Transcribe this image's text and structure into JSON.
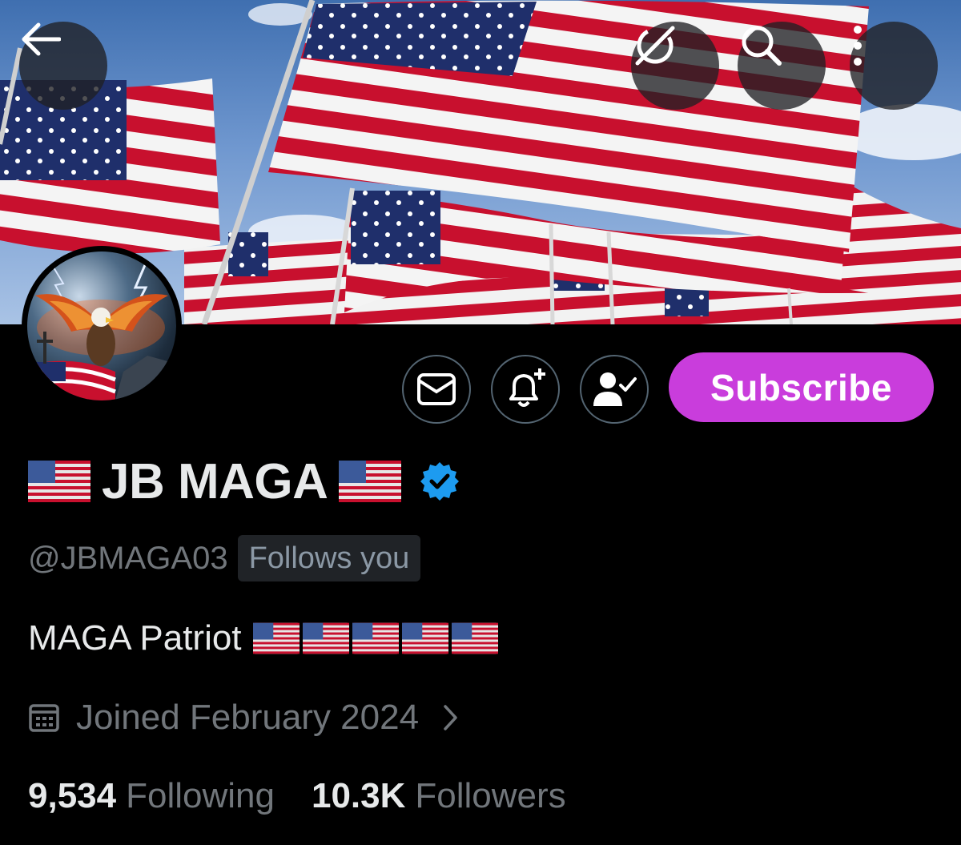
{
  "header": {
    "back_icon": "arrow-left-icon",
    "grok_icon": "grok-icon",
    "search_icon": "search-icon",
    "more_icon": "more-vertical-icon"
  },
  "banner": {
    "description_icon": "american-flags-banner"
  },
  "profile": {
    "display_name": "JB MAGA",
    "name_flag_icon": "us-flag-emoji",
    "verified_icon": "verified-badge-icon",
    "verified_color": "#1d9bf0",
    "handle": "@JBMAGA03",
    "follows_you": "Follows you",
    "bio": "MAGA Patriot",
    "bio_flag_count": 5,
    "joined": "Joined February 2024",
    "joined_icon": "calendar-icon",
    "following_count": "9,534",
    "following_label": "Following",
    "followers_count": "10.3K",
    "followers_label": "Followers"
  },
  "actions": {
    "message_icon": "envelope-icon",
    "notify_icon": "bell-plus-icon",
    "following_icon": "person-check-icon",
    "subscribe_label": "Subscribe",
    "subscribe_color": "#c93ddc"
  }
}
